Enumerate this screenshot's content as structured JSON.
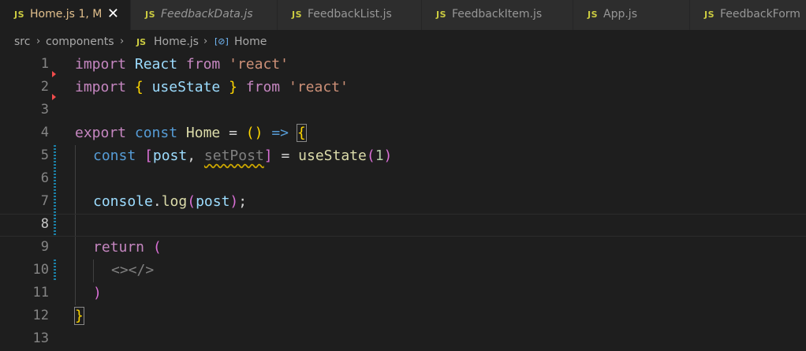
{
  "tabs": [
    {
      "icon": "JS",
      "label": "Home.js",
      "status": "1, M",
      "active": true,
      "italic": false
    },
    {
      "icon": "JS",
      "label": "FeedbackData.js",
      "status": "",
      "active": false,
      "italic": true
    },
    {
      "icon": "JS",
      "label": "FeedbackList.js",
      "status": "",
      "active": false,
      "italic": false
    },
    {
      "icon": "JS",
      "label": "FeedbackItem.js",
      "status": "",
      "active": false,
      "italic": false
    },
    {
      "icon": "JS",
      "label": "App.js",
      "status": "",
      "active": false,
      "italic": false
    },
    {
      "icon": "JS",
      "label": "FeedbackForm",
      "status": "",
      "active": false,
      "italic": false
    }
  ],
  "close_glyph": "✕",
  "breadcrumb": {
    "folder1": "src",
    "folder2": "components",
    "file_icon": "JS",
    "file": "Home.js",
    "symbol_icon": "[⊘]",
    "symbol": "Home",
    "separator": "›"
  },
  "editor": {
    "line_numbers": [
      "1",
      "2",
      "3",
      "4",
      "5",
      "6",
      "7",
      "8",
      "9",
      "10",
      "11",
      "12",
      "13"
    ],
    "active_line": "8",
    "code": {
      "l1": {
        "a": "import",
        "b": "React",
        "c": "from",
        "d": "'react'"
      },
      "l2": {
        "a": "import",
        "b": "{",
        "c": "useState",
        "d": "}",
        "e": "from",
        "f": "'react'"
      },
      "l4": {
        "a": "export",
        "b": "const",
        "c": "Home",
        "d": "=",
        "e": "()",
        "f": "=>",
        "g": "{"
      },
      "l5": {
        "a": "const",
        "b": "[",
        "c": "post",
        "d": ",",
        "e": "setPost",
        "f": "]",
        "g": "=",
        "h": "useState",
        "i": "(",
        "j": "1",
        "k": ")"
      },
      "l7": {
        "a": "console",
        ".": ".",
        "b": "log",
        "c": "(",
        "d": "post",
        "e": ")",
        "f": ";"
      },
      "l9": {
        "a": "return",
        "b": "("
      },
      "l10": {
        "a": "<></>"
      },
      "l11": {
        "a": ")"
      },
      "l12": {
        "a": "}"
      }
    }
  },
  "colors": {
    "editor_bg": "#1e1e1e",
    "tab_bar_bg": "#252526",
    "keyword": "#c586c0",
    "string": "#ce9178",
    "variable": "#9cdcfe",
    "declaration": "#569cd6",
    "function": "#dcdcaa",
    "number": "#b5cea8",
    "modified_tab": "#e2c08d"
  }
}
